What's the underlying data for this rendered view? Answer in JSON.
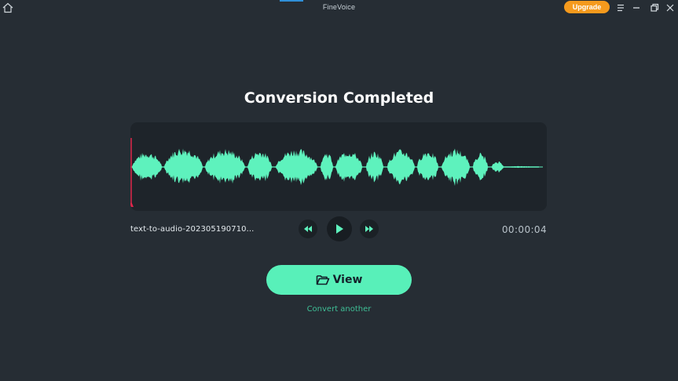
{
  "window": {
    "title": "FineVoice",
    "upgrade_label": "Upgrade",
    "accent_color": "#f59a1d",
    "icons": [
      "home-icon",
      "menu-icon",
      "minimize-icon",
      "restore-icon",
      "close-icon"
    ]
  },
  "main": {
    "heading": "Conversion Completed",
    "waveform_color": "#5ef2bd",
    "playhead_color": "#e0264b",
    "playhead_position": 0.0
  },
  "player": {
    "filename": "text-to-audio-202305190710...",
    "time": "00:00:04",
    "icons": [
      "rewind-icon",
      "play-icon",
      "fast-forward-icon"
    ]
  },
  "actions": {
    "view_label": "View",
    "view_icon": "folder-open-icon",
    "view_color": "#58f0b9",
    "convert_another_label": "Convert another"
  }
}
